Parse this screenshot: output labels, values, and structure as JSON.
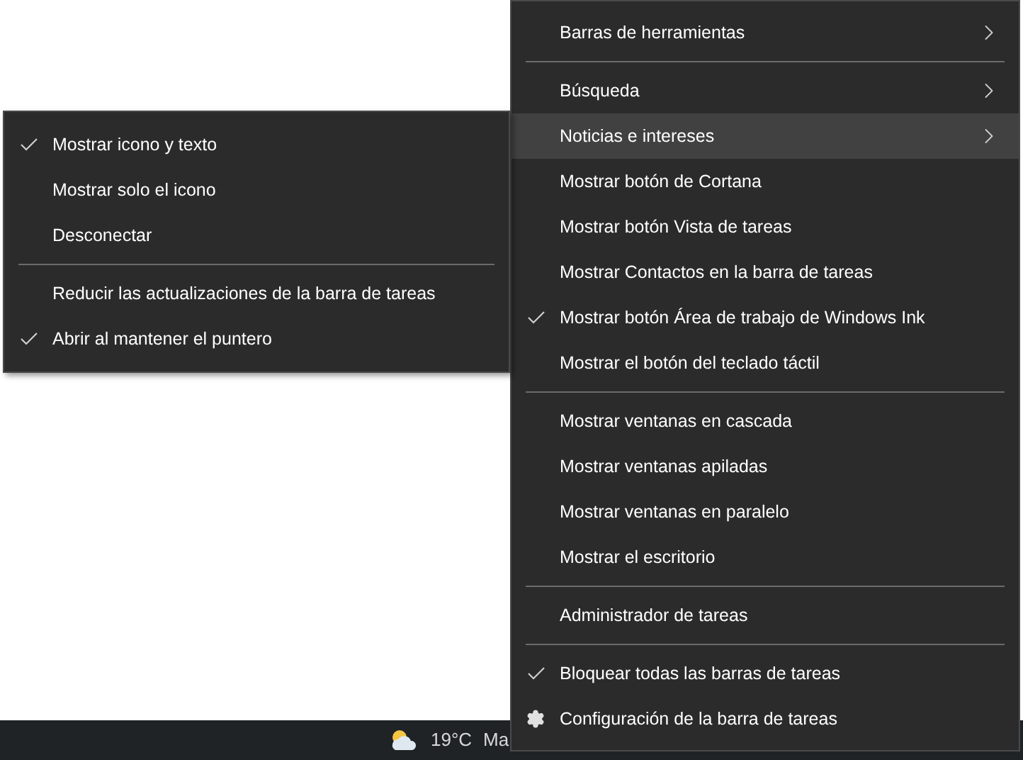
{
  "taskbar": {
    "temperature": "19°C",
    "weather_text": "Ma"
  },
  "context_menu": {
    "items": [
      {
        "kind": "item",
        "label": "Barras de herramientas",
        "checked": false,
        "submenu": true,
        "selected": false
      },
      {
        "kind": "separator"
      },
      {
        "kind": "item",
        "label": "Búsqueda",
        "checked": false,
        "submenu": true,
        "selected": false
      },
      {
        "kind": "item",
        "label": "Noticias e intereses",
        "checked": false,
        "submenu": true,
        "selected": true
      },
      {
        "kind": "item",
        "label": "Mostrar botón de Cortana",
        "checked": false,
        "submenu": false,
        "selected": false
      },
      {
        "kind": "item",
        "label": "Mostrar botón Vista de tareas",
        "checked": false,
        "submenu": false,
        "selected": false
      },
      {
        "kind": "item",
        "label": "Mostrar Contactos en la barra de tareas",
        "checked": false,
        "submenu": false,
        "selected": false
      },
      {
        "kind": "item",
        "label": "Mostrar botón Área de trabajo de Windows Ink",
        "checked": true,
        "submenu": false,
        "selected": false
      },
      {
        "kind": "item",
        "label": "Mostrar el botón del teclado táctil",
        "checked": false,
        "submenu": false,
        "selected": false
      },
      {
        "kind": "separator"
      },
      {
        "kind": "item",
        "label": "Mostrar ventanas en cascada",
        "checked": false,
        "submenu": false,
        "selected": false
      },
      {
        "kind": "item",
        "label": "Mostrar ventanas apiladas",
        "checked": false,
        "submenu": false,
        "selected": false
      },
      {
        "kind": "item",
        "label": "Mostrar ventanas en paralelo",
        "checked": false,
        "submenu": false,
        "selected": false
      },
      {
        "kind": "item",
        "label": "Mostrar el escritorio",
        "checked": false,
        "submenu": false,
        "selected": false
      },
      {
        "kind": "separator"
      },
      {
        "kind": "item",
        "label": "Administrador de tareas",
        "checked": false,
        "submenu": false,
        "selected": false
      },
      {
        "kind": "separator"
      },
      {
        "kind": "item",
        "label": "Bloquear todas las barras de tareas",
        "checked": true,
        "submenu": false,
        "selected": false
      },
      {
        "kind": "settings",
        "label": "Configuración de la barra de tareas",
        "submenu": false,
        "selected": false
      }
    ]
  },
  "submenu": {
    "items": [
      {
        "kind": "item",
        "label": "Mostrar icono y texto",
        "checked": true
      },
      {
        "kind": "item",
        "label": "Mostrar solo el icono",
        "checked": false
      },
      {
        "kind": "item",
        "label": "Desconectar",
        "checked": false
      },
      {
        "kind": "separator"
      },
      {
        "kind": "item",
        "label": "Reducir las actualizaciones de la barra de tareas",
        "checked": false
      },
      {
        "kind": "item",
        "label": "Abrir al mantener el puntero",
        "checked": true
      }
    ]
  }
}
